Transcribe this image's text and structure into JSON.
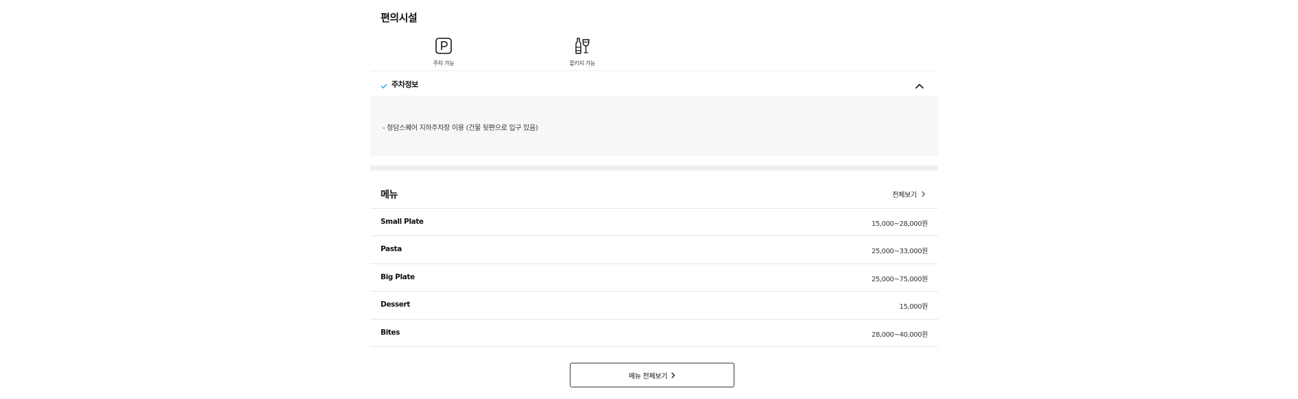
{
  "facilities": {
    "title": "편의시설",
    "items": [
      {
        "label": "주차 가능",
        "icon": "parking-icon"
      },
      {
        "label": "콜키지 가능",
        "icon": "wine-bottle-glass-icon"
      }
    ]
  },
  "parking": {
    "title": "주차정보",
    "expanded": true,
    "description": "- 청담스퀘어 지하주차장 이용 (건물 뒷편으로 입구 있음)",
    "accent_color": "#2b9fd9"
  },
  "menu": {
    "title": "메뉴",
    "view_all_link": "전체보기",
    "items": [
      {
        "name": "Small Plate",
        "price": "15,000~28,000원"
      },
      {
        "name": "Pasta",
        "price": "25,000~33,000원"
      },
      {
        "name": "Big Plate",
        "price": "25,000~75,000원"
      },
      {
        "name": "Dessert",
        "price": "15,000원"
      },
      {
        "name": "Bites",
        "price": "28,000~40,000원"
      }
    ],
    "full_menu_button": "메뉴 전체보기"
  }
}
